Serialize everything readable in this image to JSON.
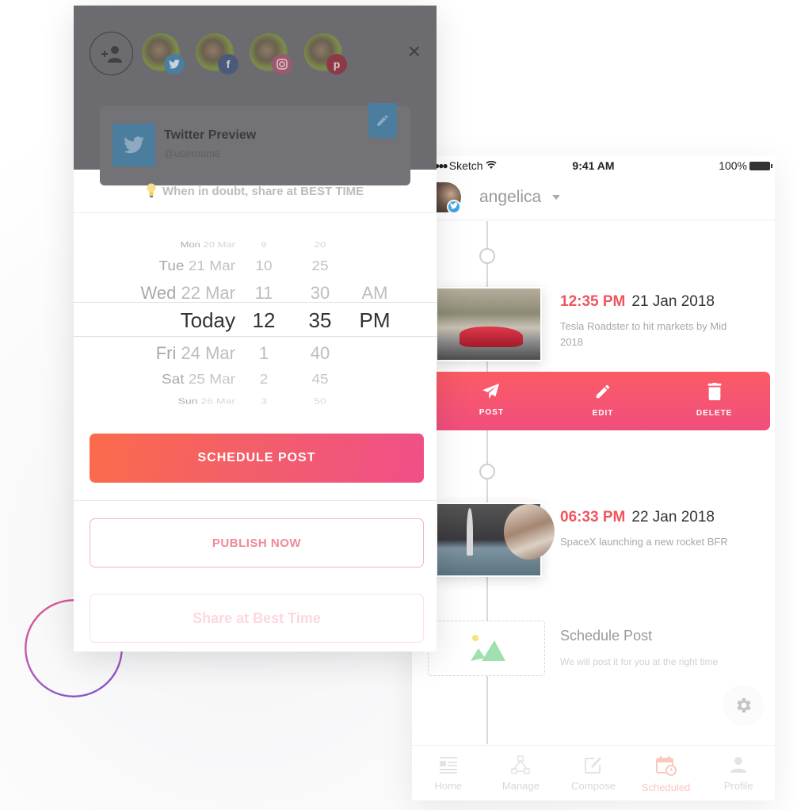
{
  "colors": {
    "accent": "#f0555f",
    "accent_pink": "#f04f88",
    "twitter": "#3ea7e8",
    "overlay": "#6b6b70"
  },
  "modal": {
    "add_account_icon": "person-add-icon",
    "accounts": [
      {
        "network": "twitter",
        "badge_icon": "twitter-icon",
        "badge_color": "#4a7d9e",
        "glyph": "t"
      },
      {
        "network": "facebook",
        "badge_icon": "facebook-icon",
        "badge_color": "#4c5a7a",
        "glyph": "f"
      },
      {
        "network": "instagram",
        "badge_icon": "instagram-icon",
        "badge_color": "#9a5a70",
        "glyph": "◎"
      },
      {
        "network": "pinterest",
        "badge_icon": "pinterest-icon",
        "badge_color": "#8c3a48",
        "glyph": "p"
      }
    ],
    "close_label": "×",
    "preview": {
      "title": "Twitter Preview",
      "handle": "@username"
    },
    "tip": {
      "icon": "💡",
      "text": "When in doubt, share at BEST TIME"
    },
    "picker": {
      "rows": [
        {
          "day": "Mon",
          "date": "20 Mar",
          "hour": "9",
          "minute": "20",
          "ampm": ""
        },
        {
          "day": "Tue",
          "date": "21 Mar",
          "hour": "10",
          "minute": "25",
          "ampm": ""
        },
        {
          "day": "Wed",
          "date": "22 Mar",
          "hour": "11",
          "minute": "30",
          "ampm": "AM"
        },
        {
          "day": "",
          "date": "Today",
          "hour": "12",
          "minute": "35",
          "ampm": "PM"
        },
        {
          "day": "Fri",
          "date": "24 Mar",
          "hour": "1",
          "minute": "40",
          "ampm": ""
        },
        {
          "day": "Sat",
          "date": "25 Mar",
          "hour": "2",
          "minute": "45",
          "ampm": ""
        },
        {
          "day": "Sun",
          "date": "26 Mar",
          "hour": "3",
          "minute": "50",
          "ampm": ""
        }
      ],
      "selected": {
        "date": "Today",
        "hour": "12",
        "minute": "35",
        "ampm": "PM"
      }
    },
    "schedule_button": "SCHEDULE POST",
    "publish_button": "PUBLISH NOW",
    "best_time_button": "Share at Best Time"
  },
  "phone": {
    "status": {
      "carrier": "Sketch",
      "time": "9:41 AM",
      "battery": "100%"
    },
    "profile": {
      "name": "angelica",
      "badge_icon": "twitter-icon"
    },
    "posts": [
      {
        "time": "12:35 PM",
        "date": "21 Jan 2018",
        "description": "Tesla Roadster to hit markets by Mid 2018"
      },
      {
        "time": "06:33 PM",
        "date": "22 Jan 2018",
        "description": "SpaceX launching a new rocket BFR"
      }
    ],
    "actions": [
      {
        "label": "POST",
        "icon": "paper-plane-icon"
      },
      {
        "label": "EDIT",
        "icon": "pencil-icon"
      },
      {
        "label": "DELETE",
        "icon": "trash-icon"
      }
    ],
    "placeholder": {
      "title": "Schedule Post",
      "subtitle": "We will post it for you at the right time"
    },
    "tabs": [
      {
        "label": "Home",
        "icon": "news-icon",
        "active": false
      },
      {
        "label": "Manage",
        "icon": "network-icon",
        "active": false
      },
      {
        "label": "Compose",
        "icon": "compose-icon",
        "active": false
      },
      {
        "label": "Scheduled",
        "icon": "calendar-clock-icon",
        "active": true
      },
      {
        "label": "Profile",
        "icon": "person-icon",
        "active": false
      }
    ]
  }
}
